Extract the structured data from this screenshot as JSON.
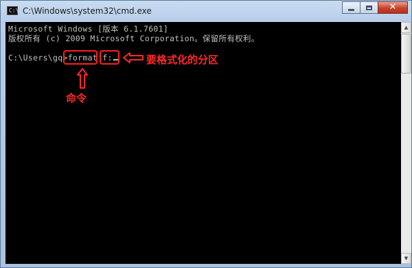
{
  "window": {
    "title": "C:\\Windows\\system32\\cmd.exe",
    "app_icon_label": "C:\\",
    "icons": {
      "app": "cmd-icon",
      "minimize": "minimize-icon",
      "maximize": "maximize-icon",
      "close": "close-icon"
    },
    "close_glyph": "✕"
  },
  "console": {
    "lines": [
      "Microsoft Windows [版本 6.1.7601]",
      "版权所有 (c) 2009 Microsoft Corporation。保留所有权利。",
      ""
    ],
    "prompt": "C:\\Users\\gq>",
    "command": "format",
    "argument": "f:",
    "text_color": "#c0c0c0",
    "background": "#000000"
  },
  "annotations": {
    "command_label": "命令",
    "partition_label": "要格式化的分区",
    "color": "#ff2a2a"
  }
}
